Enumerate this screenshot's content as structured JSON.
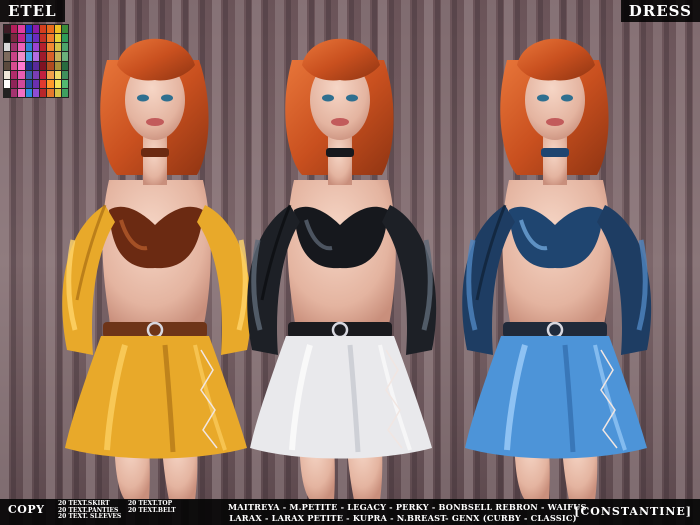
{
  "header": {
    "title_left": "ETEL",
    "title_right": "DRESS"
  },
  "swatch_colors": [
    "#3c1b24",
    "#b31e5b",
    "#e23d9e",
    "#1f39c9",
    "#8a1ba8",
    "#d43f1e",
    "#e86a1c",
    "#f0bf27",
    "#3a8c3a",
    "#111111",
    "#7a2840",
    "#c2248a",
    "#3a5fd4",
    "#6a2cbf",
    "#c23124",
    "#ef7c2a",
    "#e6d23a",
    "#2f9c58",
    "#d9d9d9",
    "#a2336d",
    "#ee63b8",
    "#2e7fd6",
    "#9b43d1",
    "#b5202d",
    "#f38a33",
    "#d6c44a",
    "#4ca36a",
    "#7d6b5d",
    "#c84387",
    "#f28cc7",
    "#47a3e6",
    "#b36ce0",
    "#9e1b2c",
    "#d9602a",
    "#c8b25a",
    "#6ab07a",
    "#5b4a3e",
    "#d64c8f",
    "#ff79d0",
    "#1e2f8a",
    "#5a2a9a",
    "#7e1222",
    "#b14a1f",
    "#a8903b",
    "#286c3f",
    "#efe6da",
    "#b02c6a",
    "#e95cb1",
    "#3b5fa8",
    "#7b3db5",
    "#c21f3f",
    "#f2a04b",
    "#efdc6a",
    "#3f8f5c",
    "#ffffff",
    "#8f2459",
    "#d14899",
    "#2c4ea6",
    "#6b2fb0",
    "#e03a2f",
    "#ff9a2b",
    "#f5e35a",
    "#52b870",
    "#222222",
    "#a43370",
    "#f06fc3",
    "#2d8ee0",
    "#8f4dd6",
    "#b8262a",
    "#e5782c",
    "#d8c248",
    "#3fa060"
  ],
  "footer": {
    "copy": "COPY",
    "stats_col1": [
      "20 TEXT.SKIRT",
      "20 TEXT.PANTIES",
      "20 TEXT. SLEEVES"
    ],
    "stats_col2": [
      "20 TEXT.TOP",
      "20 TEXT.BELT"
    ],
    "bodies_line1": "MAITREYA - M.PETITE -  LEGACY - PERKY - BONBSELL REBRON - WAIFUS",
    "bodies_line2": "LARAX - LARAX PETITE - KUPRA - N.BREAST- GENX (CURBY - CLASSIC)",
    "brand": "[CONSTANTINE]"
  },
  "outfits": [
    {
      "name": "gold",
      "main": "#e8a92a",
      "light": "#ffd56a",
      "dark": "#9c6410",
      "top": "#6b2a12",
      "top_light": "#b35a2b",
      "belt": "#6e3418"
    },
    {
      "name": "black",
      "main": "#1d2026",
      "light": "#5f6a78",
      "dark": "#07080a",
      "top": "#16181d",
      "top_light": "#5a6472",
      "belt": "#1a1a1e",
      "skirt": "#e9e9ec",
      "skirt_light": "#ffffff",
      "skirt_dark": "#b8bcc4"
    },
    {
      "name": "blue",
      "main": "#1e3d63",
      "light": "#4f86c0",
      "dark": "#0c1a2c",
      "top": "#1f4570",
      "top_light": "#6ea4d8",
      "belt": "#202a3a",
      "skirt": "#4d94d8",
      "skirt_light": "#a9d6ff",
      "skirt_dark": "#2a5f9e"
    }
  ]
}
